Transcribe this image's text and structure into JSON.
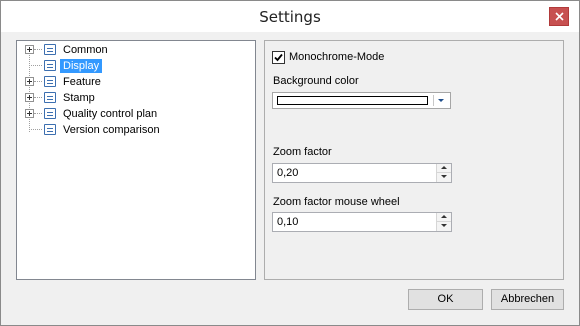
{
  "window": {
    "title": "Settings"
  },
  "tree": {
    "items": [
      {
        "label": "Common",
        "expandable": true,
        "selected": false
      },
      {
        "label": "Display",
        "expandable": false,
        "selected": true
      },
      {
        "label": "Feature",
        "expandable": true,
        "selected": false
      },
      {
        "label": "Stamp",
        "expandable": true,
        "selected": false
      },
      {
        "label": "Quality control plan",
        "expandable": true,
        "selected": false
      },
      {
        "label": "Version comparison",
        "expandable": false,
        "selected": false
      }
    ]
  },
  "display_settings": {
    "monochrome_label": "Monochrome-Mode",
    "monochrome_checked": true,
    "background_color_label": "Background color",
    "background_color_value": "#ffffff",
    "zoom_factor_label": "Zoom factor",
    "zoom_factor_value": "0,20",
    "zoom_wheel_label": "Zoom factor mouse wheel",
    "zoom_wheel_value": "0,10"
  },
  "buttons": {
    "ok": "OK",
    "cancel": "Abbrechen"
  },
  "colors": {
    "selection": "#3399ff",
    "close_button": "#c75050",
    "dialog_background": "#f0f0f0"
  }
}
